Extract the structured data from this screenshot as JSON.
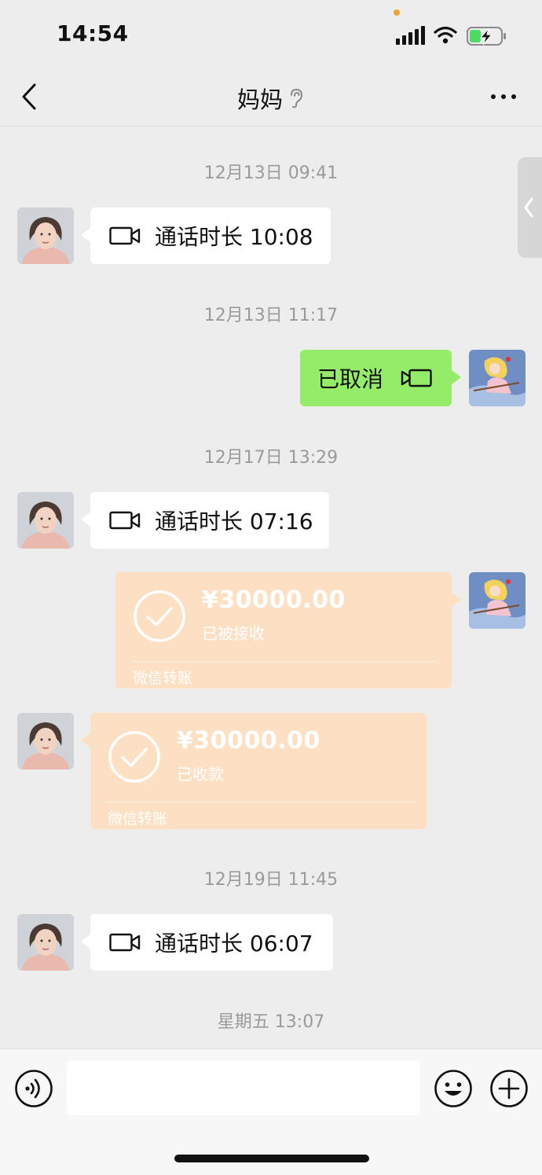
{
  "status_bar": {
    "time": "14:54"
  },
  "header": {
    "title": "妈妈"
  },
  "messages": [
    {
      "type": "timestamp",
      "text": "12月13日 09:41"
    },
    {
      "type": "video_call",
      "side": "left",
      "text": "通话时长 10:08"
    },
    {
      "type": "timestamp",
      "text": "12月13日 11:17"
    },
    {
      "type": "video_call",
      "side": "right",
      "text": "已取消"
    },
    {
      "type": "timestamp",
      "text": "12月17日 13:29"
    },
    {
      "type": "video_call",
      "side": "left",
      "text": "通话时长 07:16"
    },
    {
      "type": "transfer",
      "side": "right",
      "amount": "¥30000.00",
      "status": "已被接收",
      "label": "微信转账"
    },
    {
      "type": "transfer",
      "side": "left",
      "amount": "¥30000.00",
      "status": "已收款",
      "label": "微信转账"
    },
    {
      "type": "timestamp",
      "text": "12月19日 11:45"
    },
    {
      "type": "video_call",
      "side": "left",
      "text": "通话时长 06:07"
    },
    {
      "type": "timestamp",
      "text": "星期五 13:07"
    }
  ],
  "input": {
    "value": ""
  },
  "icons": {
    "back": "chevron-left-icon",
    "ear": "ear-icon",
    "more": "more-dots-icon",
    "video": "video-camera-icon",
    "check": "check-circle-icon",
    "voice": "voice-icon",
    "emoji": "emoji-icon",
    "plus": "plus-circle-icon"
  },
  "colors": {
    "background": "#ededed",
    "self_bubble": "#95ec69",
    "transfer_card": "#fde0c3",
    "timestamp": "#9a9a9a"
  }
}
